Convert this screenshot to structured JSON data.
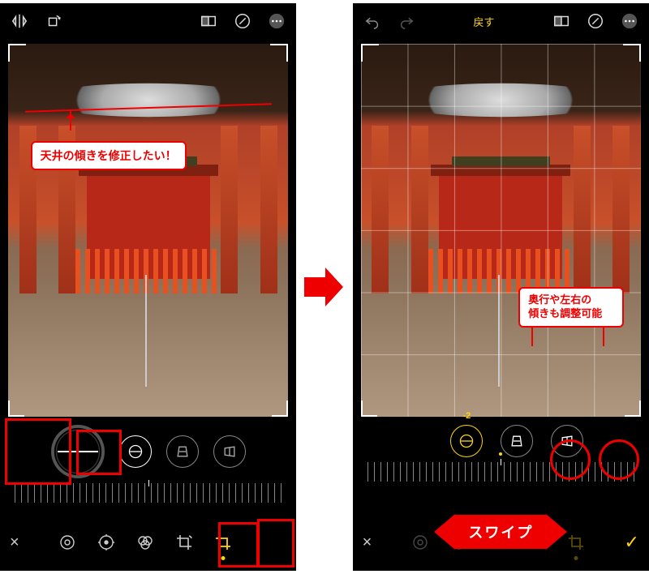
{
  "icons": {
    "flip_h": "flip-horizontal-icon",
    "rotate": "rotate-icon",
    "aspect": "aspect-ratio-icon",
    "markup": "markup-icon",
    "more": "more-icon",
    "straighten": "straighten-dial-icon",
    "vertical_persp": "vertical-perspective-icon",
    "horizontal_persp": "horizontal-perspective-icon",
    "close": "close-icon",
    "fx": "fx-target-icon",
    "adjust": "adjust-dial-icon",
    "filters": "filters-icon",
    "crop_rotate": "crop-rotate-icon",
    "crop": "crop-icon",
    "check": "check-icon",
    "undo": "undo-icon",
    "redo": "redo-icon"
  },
  "left": {
    "topbar": {
      "revert": ""
    },
    "annotation1": "天井の傾きを修正したい！",
    "dial_value": "",
    "bottom": {
      "close": "×"
    }
  },
  "right": {
    "topbar": {
      "revert": "戻す"
    },
    "annotation2": "奥行や左右の\n傾きも調整可能",
    "dial_value": "-2",
    "swipe_label": "スワイプ",
    "bottom": {
      "close": "×",
      "done": "✓"
    }
  }
}
